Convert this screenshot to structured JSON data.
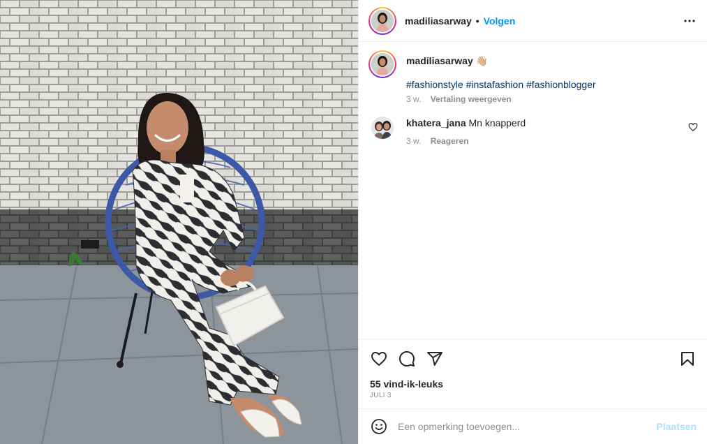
{
  "post": {
    "image_alt": "Vrouw in zebraprint outfit zittend op een blauwe stoel voor een bakstenen muur"
  },
  "header": {
    "username": "madiliasarway",
    "separator": "•",
    "follow_label": "Volgen",
    "more_icon": "more-horizontal-icon"
  },
  "caption": {
    "username": "madiliasarway",
    "emoji": "👋🏼",
    "hashtags": [
      "#fashionstyle",
      "#instafashion",
      "#fashionblogger"
    ],
    "time": "3 w.",
    "translate_label": "Vertaling weergeven"
  },
  "comments": [
    {
      "username": "khatera_jana",
      "text": "Mn knapperd",
      "time": "3 w.",
      "reply_label": "Reageren",
      "like_icon": "heart-outline-icon"
    }
  ],
  "actions": {
    "like_icon": "heart-icon",
    "comment_icon": "comment-icon",
    "share_icon": "send-icon",
    "save_icon": "bookmark-icon",
    "likes_text": "55 vind-ik-leuks",
    "date": "JULI 3"
  },
  "add_comment": {
    "emoji_icon": "smiley-icon",
    "placeholder": "Een opmerking toevoegen...",
    "post_label": "Plaatsen"
  },
  "colors": {
    "accent": "#0095f6",
    "hashtag": "#00376b",
    "muted": "#8e8e8e",
    "post_disabled": "#b2dffc"
  }
}
